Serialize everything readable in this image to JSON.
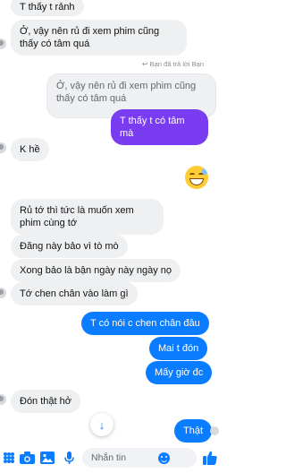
{
  "messages": {
    "m1": "T thấy t rảnh",
    "m2": "Ở, vậy nên rủ đi xem phim cũng thấy có tâm quá",
    "reply_note": "Bạn đã trả lời Bạn",
    "quoted": "Ở, vậy nên rủ đi xem phim cũng thấy có tâm quá",
    "m3": "T thấy t có tâm mà",
    "m4": "K hề",
    "m5": "Rủ tớ thì tức là muốn xem phim cùng tớ",
    "m6": "Đăng này bảo vì tò mò",
    "m7": "Xong bảo là bận ngày này ngày nọ",
    "m8": "Tớ chen chân vào làm gì",
    "m9": "T có nói c chen chân đâu",
    "m10": "Mai t đón",
    "m11": "Mấy giờ đc",
    "m12": "Đón thật hở",
    "m13": "Thật"
  },
  "composer": {
    "placeholder": "Nhắn tin"
  },
  "icons": {
    "more": "grid-icon",
    "camera": "camera-icon",
    "gallery": "image-icon",
    "mic": "microphone-icon",
    "emoji": "smile-icon",
    "like": "thumbs-up-icon",
    "scroll": "arrow-down-icon"
  },
  "colors": {
    "accent": "#0a7cff",
    "purple": "#7a3cf0"
  }
}
